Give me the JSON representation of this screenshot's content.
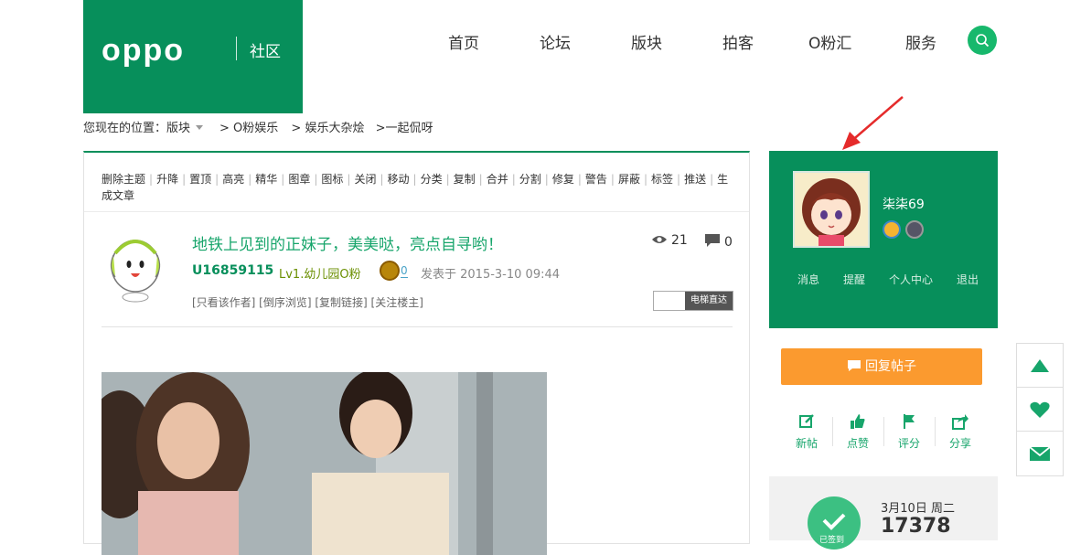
{
  "logo": {
    "brand": "oppo",
    "sub": "社区"
  },
  "nav": {
    "items": [
      "首页",
      "论坛",
      "版块",
      "拍客",
      "O粉汇",
      "服务"
    ]
  },
  "breadcrumb": {
    "prefix": "您现在的位置：版块",
    "items": [
      "> O粉娱乐",
      "> 娱乐大杂烩",
      ">一起侃呀"
    ]
  },
  "admin_bar": {
    "actions": [
      "删除主题",
      "升降",
      "置顶",
      "高亮",
      "精华",
      "图章",
      "图标",
      "关闭",
      "移动",
      "分类",
      "复制",
      "合并",
      "分割",
      "修复",
      "警告",
      "屏蔽",
      "标签",
      "推送",
      "生成文章"
    ]
  },
  "post": {
    "title": "地铁上见到的正妹子，美美哒，亮点自寻哟！",
    "views": "21",
    "comments": "0",
    "author": "U16859115",
    "level": "Lv1.幼儿园O粉",
    "medal_count": "0",
    "posted": "发表于 2015-3-10 09:44",
    "links": "[只看该作者] [倒序浏览] [复制链接] [关注楼主]",
    "elevator_label": "电梯直达"
  },
  "user": {
    "name": "柒柒69",
    "links": [
      "消息",
      "提醒",
      "个人中心",
      "退出"
    ]
  },
  "reply_button": "回复帖子",
  "actions": [
    {
      "label": "新帖",
      "icon": "edit-icon"
    },
    {
      "label": "点赞",
      "icon": "thumbs-up-icon"
    },
    {
      "label": "评分",
      "icon": "flag-icon"
    },
    {
      "label": "分享",
      "icon": "share-icon"
    }
  ],
  "sign": {
    "status": "已签到",
    "date": "3月10日 周二",
    "count": "17378"
  },
  "colors": {
    "brand_green": "#078f5b",
    "accent_green": "#17b86c",
    "orange": "#fb9a2f"
  }
}
